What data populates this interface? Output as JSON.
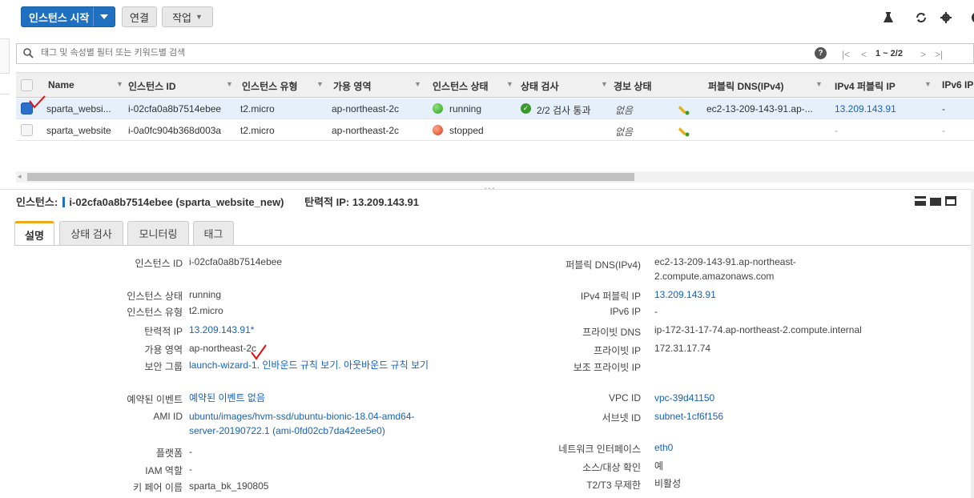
{
  "toolbar": {
    "launch_label": "인스턴스 시작",
    "connect_label": "연결",
    "actions_label": "작업"
  },
  "search": {
    "placeholder": "태그 및 속성별 필터 또는 키워드별 검색"
  },
  "pagination": {
    "range": "1 ~ 2/2"
  },
  "table": {
    "columns": [
      "Name",
      "인스턴스 ID",
      "인스턴스 유형",
      "가용 영역",
      "인스턴스 상태",
      "상태 검사",
      "경보 상태",
      "퍼블릭 DNS(IPv4)",
      "IPv4 퍼블릭 IP",
      "IPv6 IP"
    ],
    "rows": [
      {
        "name": "sparta_websi...",
        "instance_id": "i-02cfa0a8b7514ebee",
        "type": "t2.micro",
        "zone": "ap-northeast-2c",
        "state": "running",
        "status_check": "2/2 검사 통과",
        "alarm": "없음",
        "public_dns": "ec2-13-209-143-91.ap-...",
        "public_ip": "13.209.143.91",
        "ipv6": "-"
      },
      {
        "name": "sparta_website",
        "instance_id": "i-0a0fc904b368d003a",
        "type": "t2.micro",
        "zone": "ap-northeast-2c",
        "state": "stopped",
        "status_check": "",
        "alarm": "없음",
        "public_dns": "",
        "public_ip": "-",
        "ipv6": "-"
      }
    ]
  },
  "detail": {
    "prefix": "인스턴스:",
    "instance_text": "i-02cfa0a8b7514ebee (sparta_website_new)",
    "eip_text": "탄력적 IP: 13.209.143.91",
    "tabs": [
      "설명",
      "상태 검사",
      "모니터링",
      "태그"
    ],
    "left": {
      "instance_id_label": "인스턴스 ID",
      "instance_id": "i-02cfa0a8b7514ebee",
      "state_label": "인스턴스 상태",
      "state": "running",
      "type_label": "인스턴스 유형",
      "type": "t2.micro",
      "eip_label": "탄력적 IP",
      "eip": "13.209.143.91*",
      "zone_label": "가용 영역",
      "zone": "ap-northeast-2c",
      "sg_label": "보안 그룹",
      "sg": "launch-wizard-1. 인바운드 규칙 보기. 아웃바운드 규칙 보기",
      "events_label": "예약된 이벤트",
      "events": "예약된 이벤트 없음",
      "ami_label": "AMI ID",
      "ami": "ubuntu/images/hvm-ssd/ubuntu-bionic-18.04-amd64-server-20190722.1 (ami-0fd02cb7da42ee5e0)",
      "platform_label": "플랫폼",
      "platform": "-",
      "iam_label": "IAM 역할",
      "iam": "-",
      "keypair_label": "키 페어 이름",
      "keypair": "sparta_bk_190805"
    },
    "right": {
      "dns_label": "퍼블릭 DNS(IPv4)",
      "dns": "ec2-13-209-143-91.ap-northeast-2.compute.amazonaws.com",
      "ipv4_label": "IPv4 퍼블릭 IP",
      "ipv4": "13.209.143.91",
      "ipv6_label": "IPv6 IP",
      "ipv6": "-",
      "private_dns_label": "프라이빗 DNS",
      "private_dns": "ip-172-31-17-74.ap-northeast-2.compute.internal",
      "private_ip_label": "프라이빗 IP",
      "private_ip": "172.31.17.74",
      "secondary_ip_label": "보조 프라이빗 IP",
      "vpc_label": "VPC ID",
      "vpc": "vpc-39d41150",
      "subnet_label": "서브넷 ID",
      "subnet": "subnet-1cf6f156",
      "eni_label": "네트워크 인터페이스",
      "eni": "eth0",
      "srcdst_label": "소스/대상 확인",
      "srcdst": "예",
      "t2_label": "T2/T3 무제한",
      "t2": "비활성"
    }
  },
  "colors": {
    "primary": "#1f70c1",
    "link": "#1a62b6",
    "running": "#2f9e1c",
    "stopped": "#d6401e",
    "annotation": "#e01010"
  }
}
